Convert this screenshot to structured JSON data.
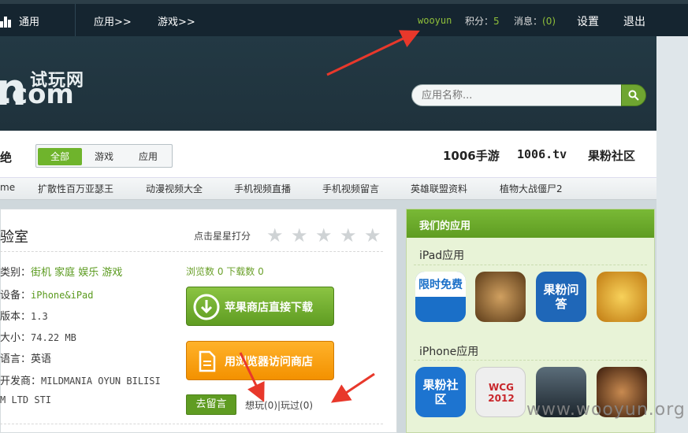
{
  "topnav": {
    "home_label": "通用",
    "apps_label": "应用>>",
    "games_label": "游戏>>",
    "username": "wooyun",
    "points_label": "积分：",
    "points_value": "5",
    "messages_label": "消息：",
    "messages_value": "(0)",
    "settings_label": "设置",
    "logout_label": "退出"
  },
  "brand": {
    "big": "n",
    "suffix": ".com",
    "cn": "试玩网"
  },
  "search": {
    "placeholder": "应用名称..."
  },
  "catbar": {
    "prefix": "绝",
    "segments": [
      "全部",
      "游戏",
      "应用"
    ],
    "active": 0,
    "quick_links": [
      "1006手游",
      "1006.tv",
      "果粉社区"
    ]
  },
  "tags": [
    "me",
    "扩散性百万亚瑟王",
    "动漫视频大全",
    "手机视频直播",
    "手机视频留言",
    "英雄联盟资料",
    "植物大战僵尸2"
  ],
  "app": {
    "title": "验室",
    "rate_label": "点击星星打分",
    "category_label": "类别：",
    "categories": "街机 家庭 娱乐 游戏",
    "device_label": "设备：",
    "device": "iPhone&iPad",
    "version_label": "版本：",
    "version": "1.3",
    "size_label": "大小：",
    "size": "74.22 MB",
    "language_label": "语言：",
    "language": "英语",
    "dev_label": "开发商：",
    "developer_line1": "MILDMANIA OYUN BILISI",
    "developer_line2": "M LTD STI",
    "stats": "浏览数 0 下载数 0",
    "appstore_button": "苹果商店直接下载",
    "browser_button": "用浏览器访问商店",
    "comment_button": "去留言",
    "want_play": "想玩(0)|玩过(0)"
  },
  "side": {
    "header": "我们的应用",
    "ipad_title": "iPad应用",
    "iphone_title": "iPhone应用",
    "ipad_icons": [
      {
        "name": "limited-free-icon",
        "text": "限时免费",
        "color": "#1a6fc8"
      },
      {
        "name": "pirate-game-icon",
        "text": "",
        "color": "#8a5a2a"
      },
      {
        "name": "guofen-qa-icon",
        "text": "果粉问答",
        "color": "#1f67b8"
      },
      {
        "name": "cartoon-video-icon",
        "text": "",
        "color": "#e0a21a"
      }
    ],
    "iphone_icons": [
      {
        "name": "guofen-community-icon",
        "text": "果粉社区",
        "color": "#1d74d0"
      },
      {
        "name": "wcg-2012-icon",
        "text": "WCG 2012",
        "color": "#eaeaea"
      },
      {
        "name": "starcraft-icon",
        "text": "",
        "color": "#2d3a44"
      },
      {
        "name": "warrior-game-icon",
        "text": "",
        "color": "#6a3a20"
      }
    ]
  },
  "watermark": "www.wooyun.org"
}
